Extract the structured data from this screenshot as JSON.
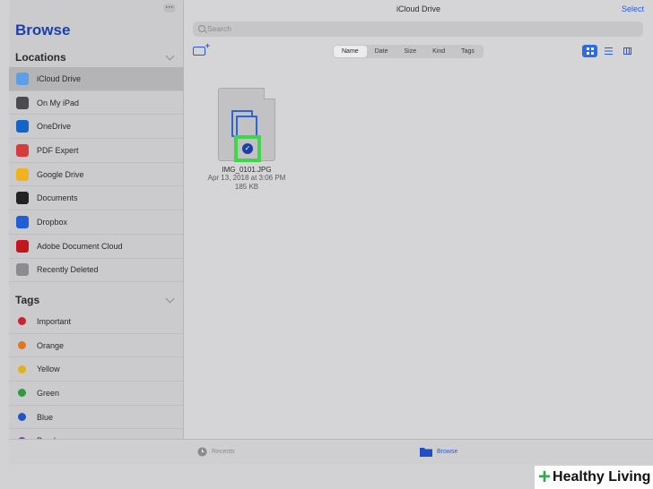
{
  "sidebar": {
    "more_label": "···",
    "title": "Browse",
    "locations_header": "Locations",
    "locations": [
      {
        "label": "iCloud Drive",
        "icon": "icloud-icon",
        "color": "#5aa0e8",
        "selected": true
      },
      {
        "label": "On My iPad",
        "icon": "ipad-icon",
        "color": "#4a4a4f"
      },
      {
        "label": "OneDrive",
        "icon": "onedrive-icon",
        "color": "#1565c8"
      },
      {
        "label": "PDF Expert",
        "icon": "pdf-expert-icon",
        "color": "#d83b3b"
      },
      {
        "label": "Google Drive",
        "icon": "google-drive-icon",
        "color": "#f2b21c"
      },
      {
        "label": "Documents",
        "icon": "documents-icon",
        "color": "#222222"
      },
      {
        "label": "Dropbox",
        "icon": "dropbox-icon",
        "color": "#1f5fd6"
      },
      {
        "label": "Adobe Document Cloud",
        "icon": "adobe-icon",
        "color": "#c4161c"
      },
      {
        "label": "Recently Deleted",
        "icon": "trash-icon",
        "color": "#8b8b90"
      }
    ],
    "tags_header": "Tags",
    "tags": [
      {
        "label": "Important",
        "color": "#c8242b"
      },
      {
        "label": "Orange",
        "color": "#e2761f"
      },
      {
        "label": "Yellow",
        "color": "#e0b21f"
      },
      {
        "label": "Green",
        "color": "#2f9a3e"
      },
      {
        "label": "Blue",
        "color": "#1e55c8"
      },
      {
        "label": "Purple",
        "color": "#8a3bb5"
      }
    ]
  },
  "main": {
    "title": "iCloud Drive",
    "select_label": "Select",
    "search_placeholder": "Search",
    "sort_options": [
      "Name",
      "Date",
      "Size",
      "Kind",
      "Tags"
    ],
    "sort_selected": "Name",
    "file": {
      "name": "IMG_0101.JPG",
      "date": "Apr 13, 2018 at 3:06 PM",
      "size": "185 KB"
    }
  },
  "tabbar": {
    "recents_label": "Recents",
    "browse_label": "Browse"
  },
  "watermark": {
    "text": "Healthy Living",
    "accent": "#2fa84f"
  }
}
